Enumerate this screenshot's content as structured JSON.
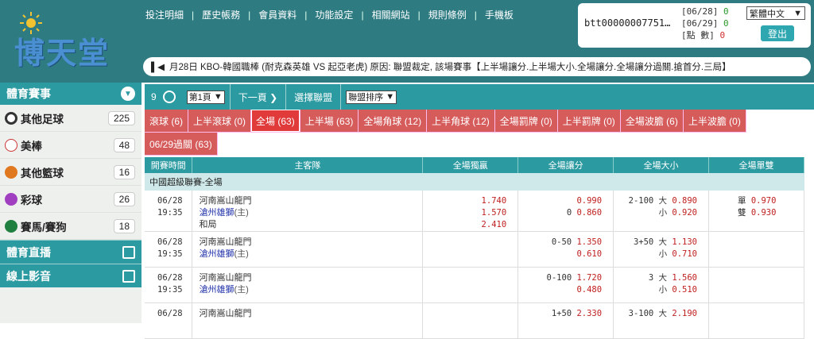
{
  "brand": {
    "logo_text": "博天堂"
  },
  "topnav": [
    "投注明細",
    "歷史帳務",
    "會員資料",
    "功能設定",
    "相關網站",
    "規則條例",
    "手機板"
  ],
  "account": {
    "user_id": "btt00000007751…",
    "rows": [
      {
        "label": "[06/28]",
        "value": "0",
        "color": "green"
      },
      {
        "label": "[06/29]",
        "value": "0",
        "color": "green"
      },
      {
        "label": "[點 數]",
        "value": "0",
        "color": "red"
      }
    ],
    "language": "繁體中文",
    "logout": "登出"
  },
  "ticker": {
    "text": "月28日 KBO-韓國職棒 (耐克森英雄 VS 起亞老虎) 原因: 聯盟裁定, 該場賽事【上半場讓分.上半場大小.全場讓分.全場讓分過關.搶首分.三局】"
  },
  "sidebar": {
    "header": "體育賽事",
    "items": [
      {
        "label": "其他足球",
        "count": "225",
        "icon": "soccer-ball-icon",
        "color": "#333333"
      },
      {
        "label": "美棒",
        "count": "48",
        "icon": "baseball-icon",
        "color": "#cc3333"
      },
      {
        "label": "其他籃球",
        "count": "16",
        "icon": "basketball-icon",
        "color": "#e07820"
      },
      {
        "label": "彩球",
        "count": "26",
        "icon": "lottery-ball-icon",
        "color": "#a040c0"
      },
      {
        "label": "賽馬/賽狗",
        "count": "18",
        "icon": "racing-icon",
        "color": "#208040"
      }
    ],
    "links": [
      "體育直播",
      "線上影音"
    ]
  },
  "toolbar": {
    "count": "9",
    "page_select": "第1頁",
    "next_page": "下一頁",
    "choose_league": "選擇聯盟",
    "sort_select": "聯盟排序"
  },
  "tabs": [
    "滾球 (6)",
    "上半滾球 (0)",
    "全場 (63)",
    "上半場 (63)",
    "全場角球 (12)",
    "上半角球 (12)",
    "全場罰牌 (0)",
    "上半罰牌 (0)",
    "全場波膽 (6)",
    "上半波膽 (0)",
    "06/29過關 (63)"
  ],
  "active_tab": "全場 (63)",
  "table": {
    "headers": [
      "開賽時間",
      "主客隊",
      "全場獨贏",
      "全場讓分",
      "全場大小",
      "全場單雙"
    ],
    "league": "中國超級聯賽-全場",
    "games": [
      {
        "date": "06/28",
        "time": "19:35",
        "team_a": "河南嵩山龍門",
        "team_b": "滄州雄獅",
        "home": "(主)",
        "draw": "和局",
        "moneyline": [
          "1.740",
          "1.570",
          "2.410"
        ],
        "handicap": {
          "line_a": "",
          "odds_a": "0.990",
          "line_b": "0",
          "odds_b": "0.860"
        },
        "totals": {
          "line_a": "2-100 大",
          "odds_a": "0.890",
          "line_b": "小",
          "odds_b": "0.920"
        },
        "oddeven": {
          "odd_label": "單",
          "odd": "0.970",
          "even_label": "雙",
          "even": "0.930"
        }
      },
      {
        "date": "06/28",
        "time": "19:35",
        "team_a": "河南嵩山龍門",
        "team_b": "滄州雄獅",
        "home": "(主)",
        "draw": "",
        "moneyline": [
          "",
          "",
          ""
        ],
        "handicap": {
          "line_a": "0-50",
          "odds_a": "1.350",
          "line_b": "",
          "odds_b": "0.610"
        },
        "totals": {
          "line_a": "3+50 大",
          "odds_a": "1.130",
          "line_b": "小",
          "odds_b": "0.710"
        },
        "oddeven": {
          "odd_label": "",
          "odd": "",
          "even_label": "",
          "even": ""
        }
      },
      {
        "date": "06/28",
        "time": "19:35",
        "team_a": "河南嵩山龍門",
        "team_b": "滄州雄獅",
        "home": "(主)",
        "draw": "",
        "moneyline": [
          "",
          "",
          ""
        ],
        "handicap": {
          "line_a": "0-100",
          "odds_a": "1.720",
          "line_b": "",
          "odds_b": "0.480"
        },
        "totals": {
          "line_a": "3 大",
          "odds_a": "1.560",
          "line_b": "小",
          "odds_b": "0.510"
        },
        "oddeven": {
          "odd_label": "",
          "odd": "",
          "even_label": "",
          "even": ""
        }
      },
      {
        "date": "06/28",
        "time": "",
        "team_a": "河南嵩山龍門",
        "team_b": "",
        "home": "",
        "draw": "",
        "moneyline": [
          "",
          "",
          ""
        ],
        "handicap": {
          "line_a": "1+50",
          "odds_a": "2.330",
          "line_b": "",
          "odds_b": ""
        },
        "totals": {
          "line_a": "3-100 大",
          "odds_a": "2.190",
          "line_b": "",
          "odds_b": ""
        },
        "oddeven": {
          "odd_label": "",
          "odd": "",
          "even_label": "",
          "even": ""
        }
      }
    ]
  }
}
